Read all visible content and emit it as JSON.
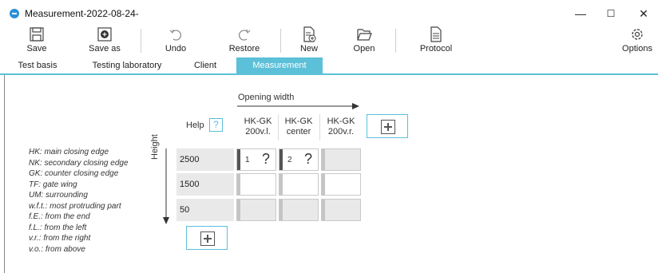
{
  "window": {
    "title": "Measurement-2022-08-24-",
    "minimize": "—",
    "maximize": "☐",
    "close": "✕"
  },
  "ribbon": {
    "save": "Save",
    "save_as": "Save as",
    "undo": "Undo",
    "restore": "Restore",
    "new": "New",
    "open": "Open",
    "protocol": "Protocol",
    "options": "Options"
  },
  "tabs": [
    "Test basis",
    "Testing laboratory",
    "Client",
    "Measurement"
  ],
  "active_tab": "Measurement",
  "measurement": {
    "opening_width_label": "Opening width",
    "help_label": "Help",
    "help_icon": "?",
    "height_label": "Height",
    "columns": [
      {
        "line1": "HK-GK",
        "line2": "200v.l."
      },
      {
        "line1": "HK-GK",
        "line2": "center"
      },
      {
        "line1": "HK-GK",
        "line2": "200v.r."
      }
    ],
    "rows": [
      {
        "label": "2500",
        "cells": [
          {
            "num": "1",
            "q": "?"
          },
          {
            "num": "2",
            "q": "?"
          },
          {}
        ]
      },
      {
        "label": "1500"
      },
      {
        "label": "50"
      }
    ]
  },
  "legend": [
    "HK: main closing edge",
    "NK: secondary closing edge",
    "GK: counter closing edge",
    "TF: gate wing",
    "UM: surrounding",
    "w.f.t.: most protruding part",
    "f.E.: from the end",
    "f.L.: from the left",
    "v.r.: from the right",
    "v.o.: from above"
  ]
}
